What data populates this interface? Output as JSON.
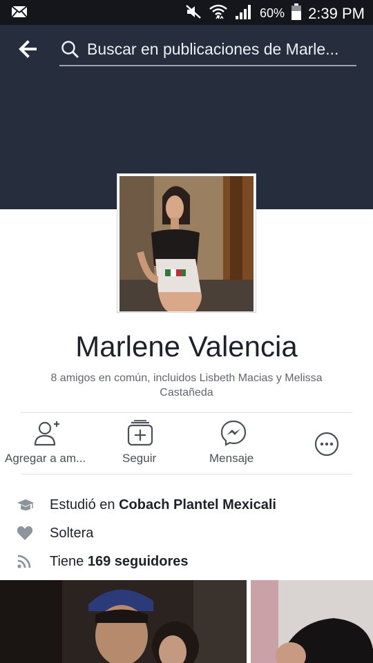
{
  "status_bar": {
    "battery": "60%",
    "time": "2:39 PM",
    "icons": [
      "mail-icon",
      "mute-icon",
      "wifi-icon",
      "signal-icon",
      "battery-icon"
    ]
  },
  "header": {
    "search_placeholder": "Buscar en publicaciones de Marle..."
  },
  "profile": {
    "name": "Marlene Valencia",
    "mutual_friends": "8 amigos en común, incluidos Lisbeth Macias y Melissa Castañeda"
  },
  "actions": [
    {
      "label": "Agregar a am...",
      "icon": "add-friend-icon"
    },
    {
      "label": "Seguir",
      "icon": "follow-icon"
    },
    {
      "label": "Mensaje",
      "icon": "messenger-icon"
    },
    {
      "label": "",
      "icon": "more-icon"
    }
  ],
  "info": {
    "education_prefix": "Estudió en ",
    "education_place": "Cobach Plantel Mexicali",
    "relationship": "Soltera",
    "followers_prefix": "Tiene ",
    "followers_value": "169 seguidores"
  },
  "colors": {
    "header_bg": "#262d3d",
    "status_bg": "#14161b",
    "text_primary": "#1d2129",
    "text_secondary": "#606770",
    "icon_gray": "#8d949e",
    "messenger_blue": "#4b4f56"
  }
}
